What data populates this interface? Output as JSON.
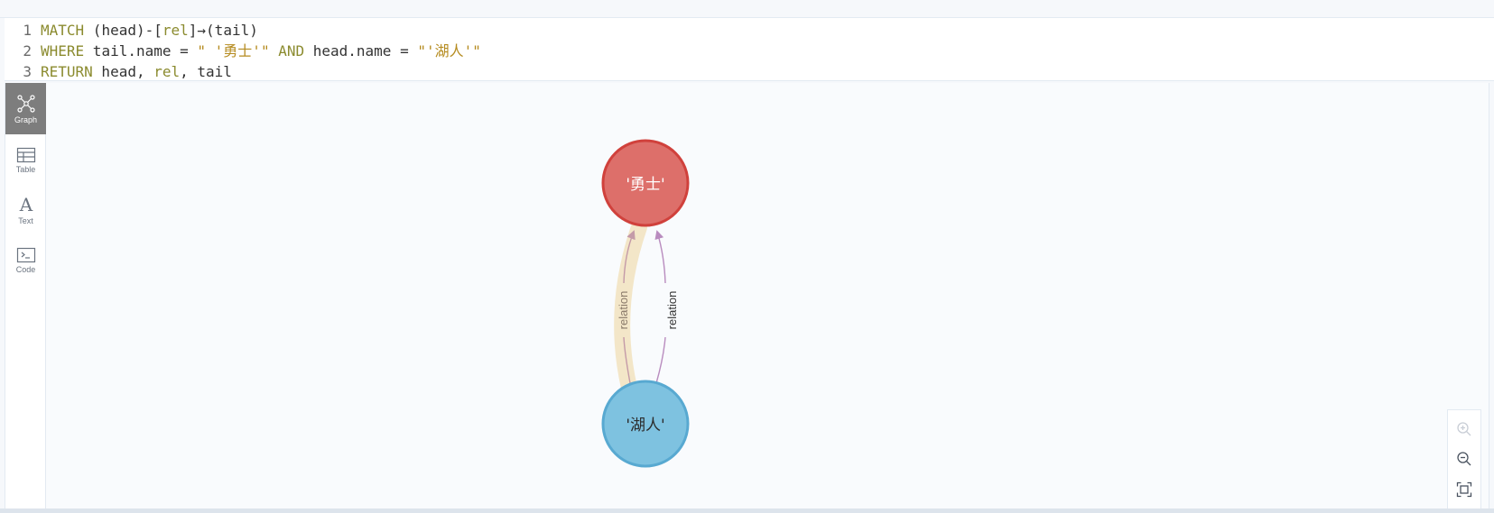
{
  "editor": {
    "lines": [
      {
        "num": "1",
        "tokens": [
          {
            "t": "MATCH",
            "c": "kw"
          },
          {
            "t": " (head)-[",
            "c": "plain"
          },
          {
            "t": "rel",
            "c": "rel"
          },
          {
            "t": "]→(tail)",
            "c": "plain"
          }
        ]
      },
      {
        "num": "2",
        "tokens": [
          {
            "t": "WHERE",
            "c": "kw"
          },
          {
            "t": " tail.name = ",
            "c": "plain"
          },
          {
            "t": "\" '勇士'\"",
            "c": "str"
          },
          {
            "t": " AND",
            "c": "kw"
          },
          {
            "t": " head.name = ",
            "c": "plain"
          },
          {
            "t": "\"'湖人'\"",
            "c": "str"
          }
        ]
      },
      {
        "num": "3",
        "tokens": [
          {
            "t": "RETURN",
            "c": "kw"
          },
          {
            "t": " head, ",
            "c": "plain"
          },
          {
            "t": "rel",
            "c": "rel"
          },
          {
            "t": ", tail",
            "c": "plain"
          }
        ]
      }
    ]
  },
  "sidebar": {
    "items": [
      {
        "label": "Graph",
        "icon": "graph-icon",
        "active": true
      },
      {
        "label": "Table",
        "icon": "table-icon",
        "active": false
      },
      {
        "label": "Text",
        "icon": "text-icon",
        "active": false
      },
      {
        "label": "Code",
        "icon": "code-icon",
        "active": false
      }
    ]
  },
  "graph": {
    "nodes": [
      {
        "id": "warriors",
        "label": "'勇士'",
        "fill": "#dd6f6a",
        "stroke": "#d0413c",
        "text_color": "#ffffff"
      },
      {
        "id": "lakers",
        "label": "'湖人'",
        "fill": "#7ec2e0",
        "stroke": "#58a9d1",
        "text_color": "#2b2b2b"
      }
    ],
    "edges": [
      {
        "label": "relation",
        "color": "#c49aa8",
        "highlight": "#f3e6c8"
      },
      {
        "label": "relation",
        "color": "#b98cbf"
      }
    ]
  },
  "zoom": {
    "zoom_in_icon": "zoom-in-icon",
    "zoom_out_icon": "zoom-out-icon",
    "fit_icon": "fit-screen-icon"
  }
}
